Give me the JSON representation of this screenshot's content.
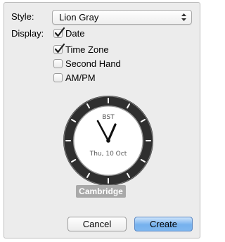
{
  "style_field": {
    "label": "Style:",
    "selected": "Lion Gray"
  },
  "display_field": {
    "label": "Display:",
    "options": [
      {
        "label": "Date",
        "checked": true
      },
      {
        "label": "Time Zone",
        "checked": true
      },
      {
        "label": "Second Hand",
        "checked": false
      },
      {
        "label": "AM/PM",
        "checked": false
      }
    ]
  },
  "clock": {
    "timezone": "BST",
    "date": "Thu, 10 Oct",
    "city": "Cambridge"
  },
  "buttons": {
    "cancel": "Cancel",
    "create": "Create"
  },
  "colors": {
    "accent": "#76b1ee",
    "bezel": "#3a3a3a",
    "badge": "#a9a9a9"
  }
}
